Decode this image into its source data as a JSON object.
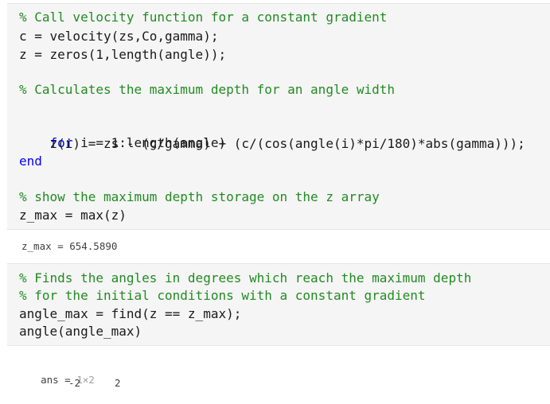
{
  "cell1": {
    "lines": [
      {
        "type": "comment",
        "text": "% Call velocity function for a constant gradient"
      },
      {
        "type": "plain",
        "text": "c = velocity(zs,Co,gamma);"
      },
      {
        "type": "plain",
        "text": "z = zeros(1,length(angle));"
      },
      {
        "type": "blank",
        "text": ""
      },
      {
        "type": "comment",
        "text": "% Calculates the maximum depth for an angle width"
      },
      {
        "type": "blank",
        "text": ""
      },
      {
        "type": "for",
        "keyword": "for",
        "text": " i = 1:length(angle)"
      },
      {
        "type": "plain",
        "text": "    z(i) = zs - (c/gamma) + (c/(cos(angle(i)*pi/180)*abs(gamma)));"
      },
      {
        "type": "keyword",
        "text": "end"
      },
      {
        "type": "blank",
        "text": ""
      },
      {
        "type": "comment",
        "text": "% show the maximum depth storage on the z array"
      },
      {
        "type": "plain",
        "text": "z_max = max(z)"
      }
    ]
  },
  "output1": {
    "text": "z_max = 654.5890"
  },
  "cell2": {
    "lines": [
      {
        "type": "comment",
        "text": "% Finds the angles in degrees which reach the maximum depth"
      },
      {
        "type": "comment",
        "text": "% for the initial conditions with a constant gradient"
      },
      {
        "type": "plain",
        "text": "angle_max = find(z == z_max);"
      },
      {
        "type": "plain",
        "text": "angle(angle_max)"
      }
    ]
  },
  "output2": {
    "label": "ans = ",
    "size": "1×2",
    "values": [
      "-2",
      "2"
    ]
  }
}
